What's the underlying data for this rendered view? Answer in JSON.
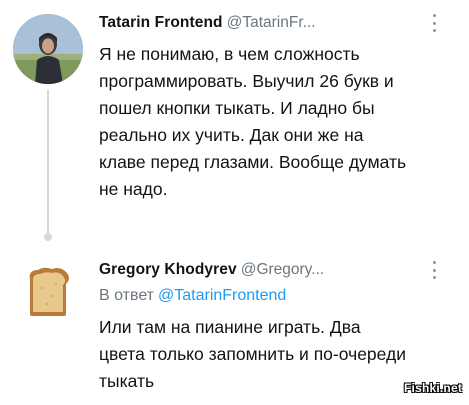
{
  "tweet1": {
    "name": "Tatarin Frontend",
    "handle": "@TatarinFr...",
    "text": "Я не понимаю, в чем сложность\nпрограммировать. Выучил 26 букв и\nпошел кнопки тыкать. И ладно бы\nреально их учить. Дак они же на\nклаве перед глазами. Вообще думать\nне надо."
  },
  "tweet2": {
    "name": "Gregory Khodyrev",
    "handle": "@Gregory...",
    "reply_prefix": "В ответ",
    "reply_handle": "@TatarinFrontend",
    "text": "Или там на пианине играть. Два\nцвета только запомнить и по-очереди\nтыкать"
  },
  "watermark": "Fishki.net",
  "icons": {
    "avatar1": "user-photo-avatar",
    "avatar2": "toast-avatar",
    "more": "more-options-icon"
  }
}
